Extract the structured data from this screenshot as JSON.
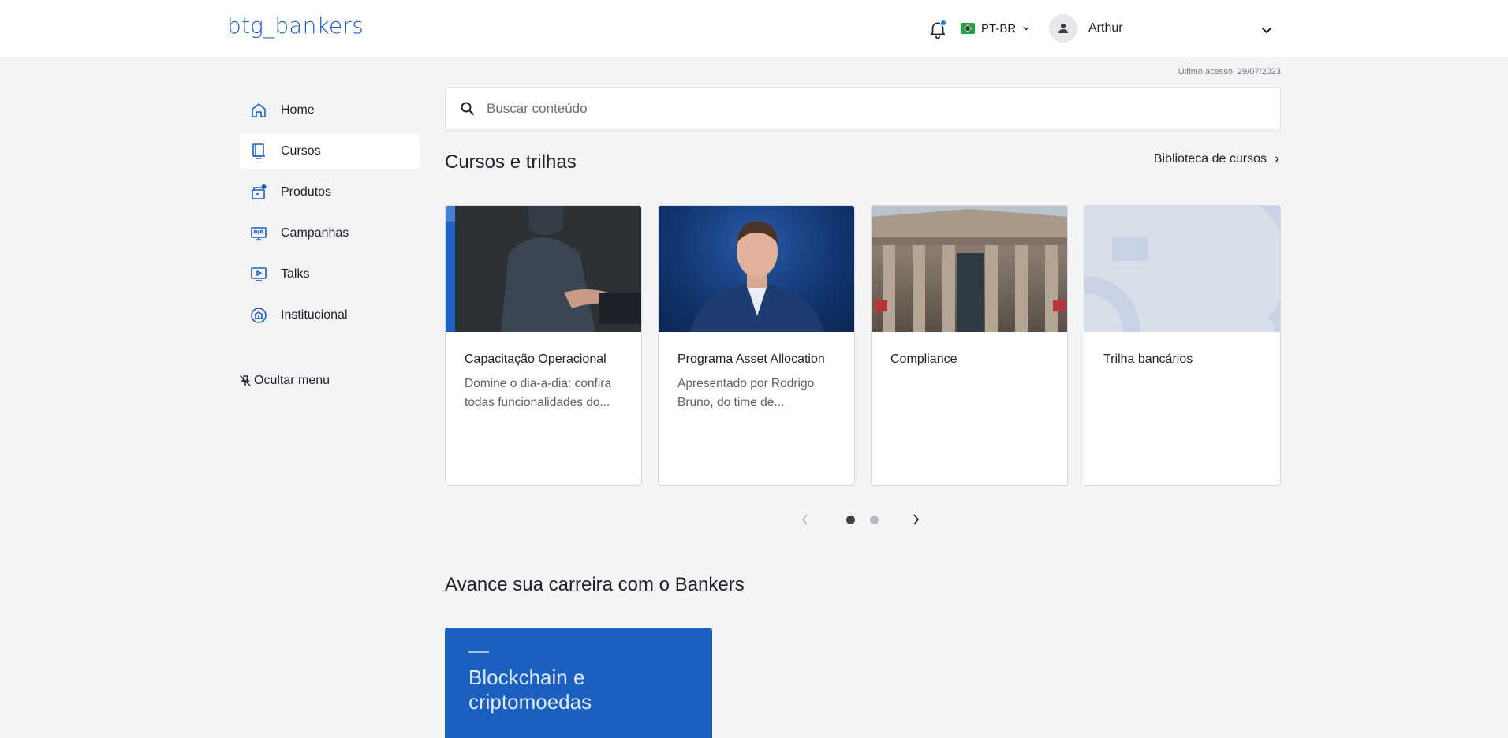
{
  "header": {
    "logo": "btg_bankers",
    "language": "PT-BR",
    "user_name": "Arthur"
  },
  "last_access": "Último acesso: 29/07/2023",
  "sidebar": {
    "items": [
      {
        "label": "Home",
        "icon": "home-icon",
        "active": false
      },
      {
        "label": "Cursos",
        "icon": "book-icon",
        "active": true
      },
      {
        "label": "Produtos",
        "icon": "products-icon",
        "active": false
      },
      {
        "label": "Campanhas",
        "icon": "campaign-icon",
        "active": false
      },
      {
        "label": "Talks",
        "icon": "video-play-icon",
        "active": false
      },
      {
        "label": "Institucional",
        "icon": "institution-icon",
        "active": false
      }
    ],
    "hide_menu": "Ocultar menu"
  },
  "search": {
    "placeholder": "Buscar conteúdo",
    "value": ""
  },
  "courses_section": {
    "title": "Cursos e trilhas",
    "library_link": "Biblioteca de cursos",
    "cards": [
      {
        "title": "Capacitação Operacional",
        "description": "Domine o dia-a-dia: confira todas funcionalidades do..."
      },
      {
        "title": "Programa Asset Allocation",
        "description": "Apresentado por Rodrigo Bruno, do time de..."
      },
      {
        "title": "Compliance",
        "description": ""
      },
      {
        "title": "Trilha bancários",
        "description": ""
      }
    ],
    "carousel": {
      "current_page": 1,
      "total_pages": 2
    }
  },
  "career_section": {
    "title": "Avance sua carreira com o Bankers",
    "promo_title": "Blockchain e criptomoedas"
  },
  "colors": {
    "brand": "#1b5fbf",
    "background": "#f3f4f5",
    "notification_dot": "#1e7bf0"
  }
}
